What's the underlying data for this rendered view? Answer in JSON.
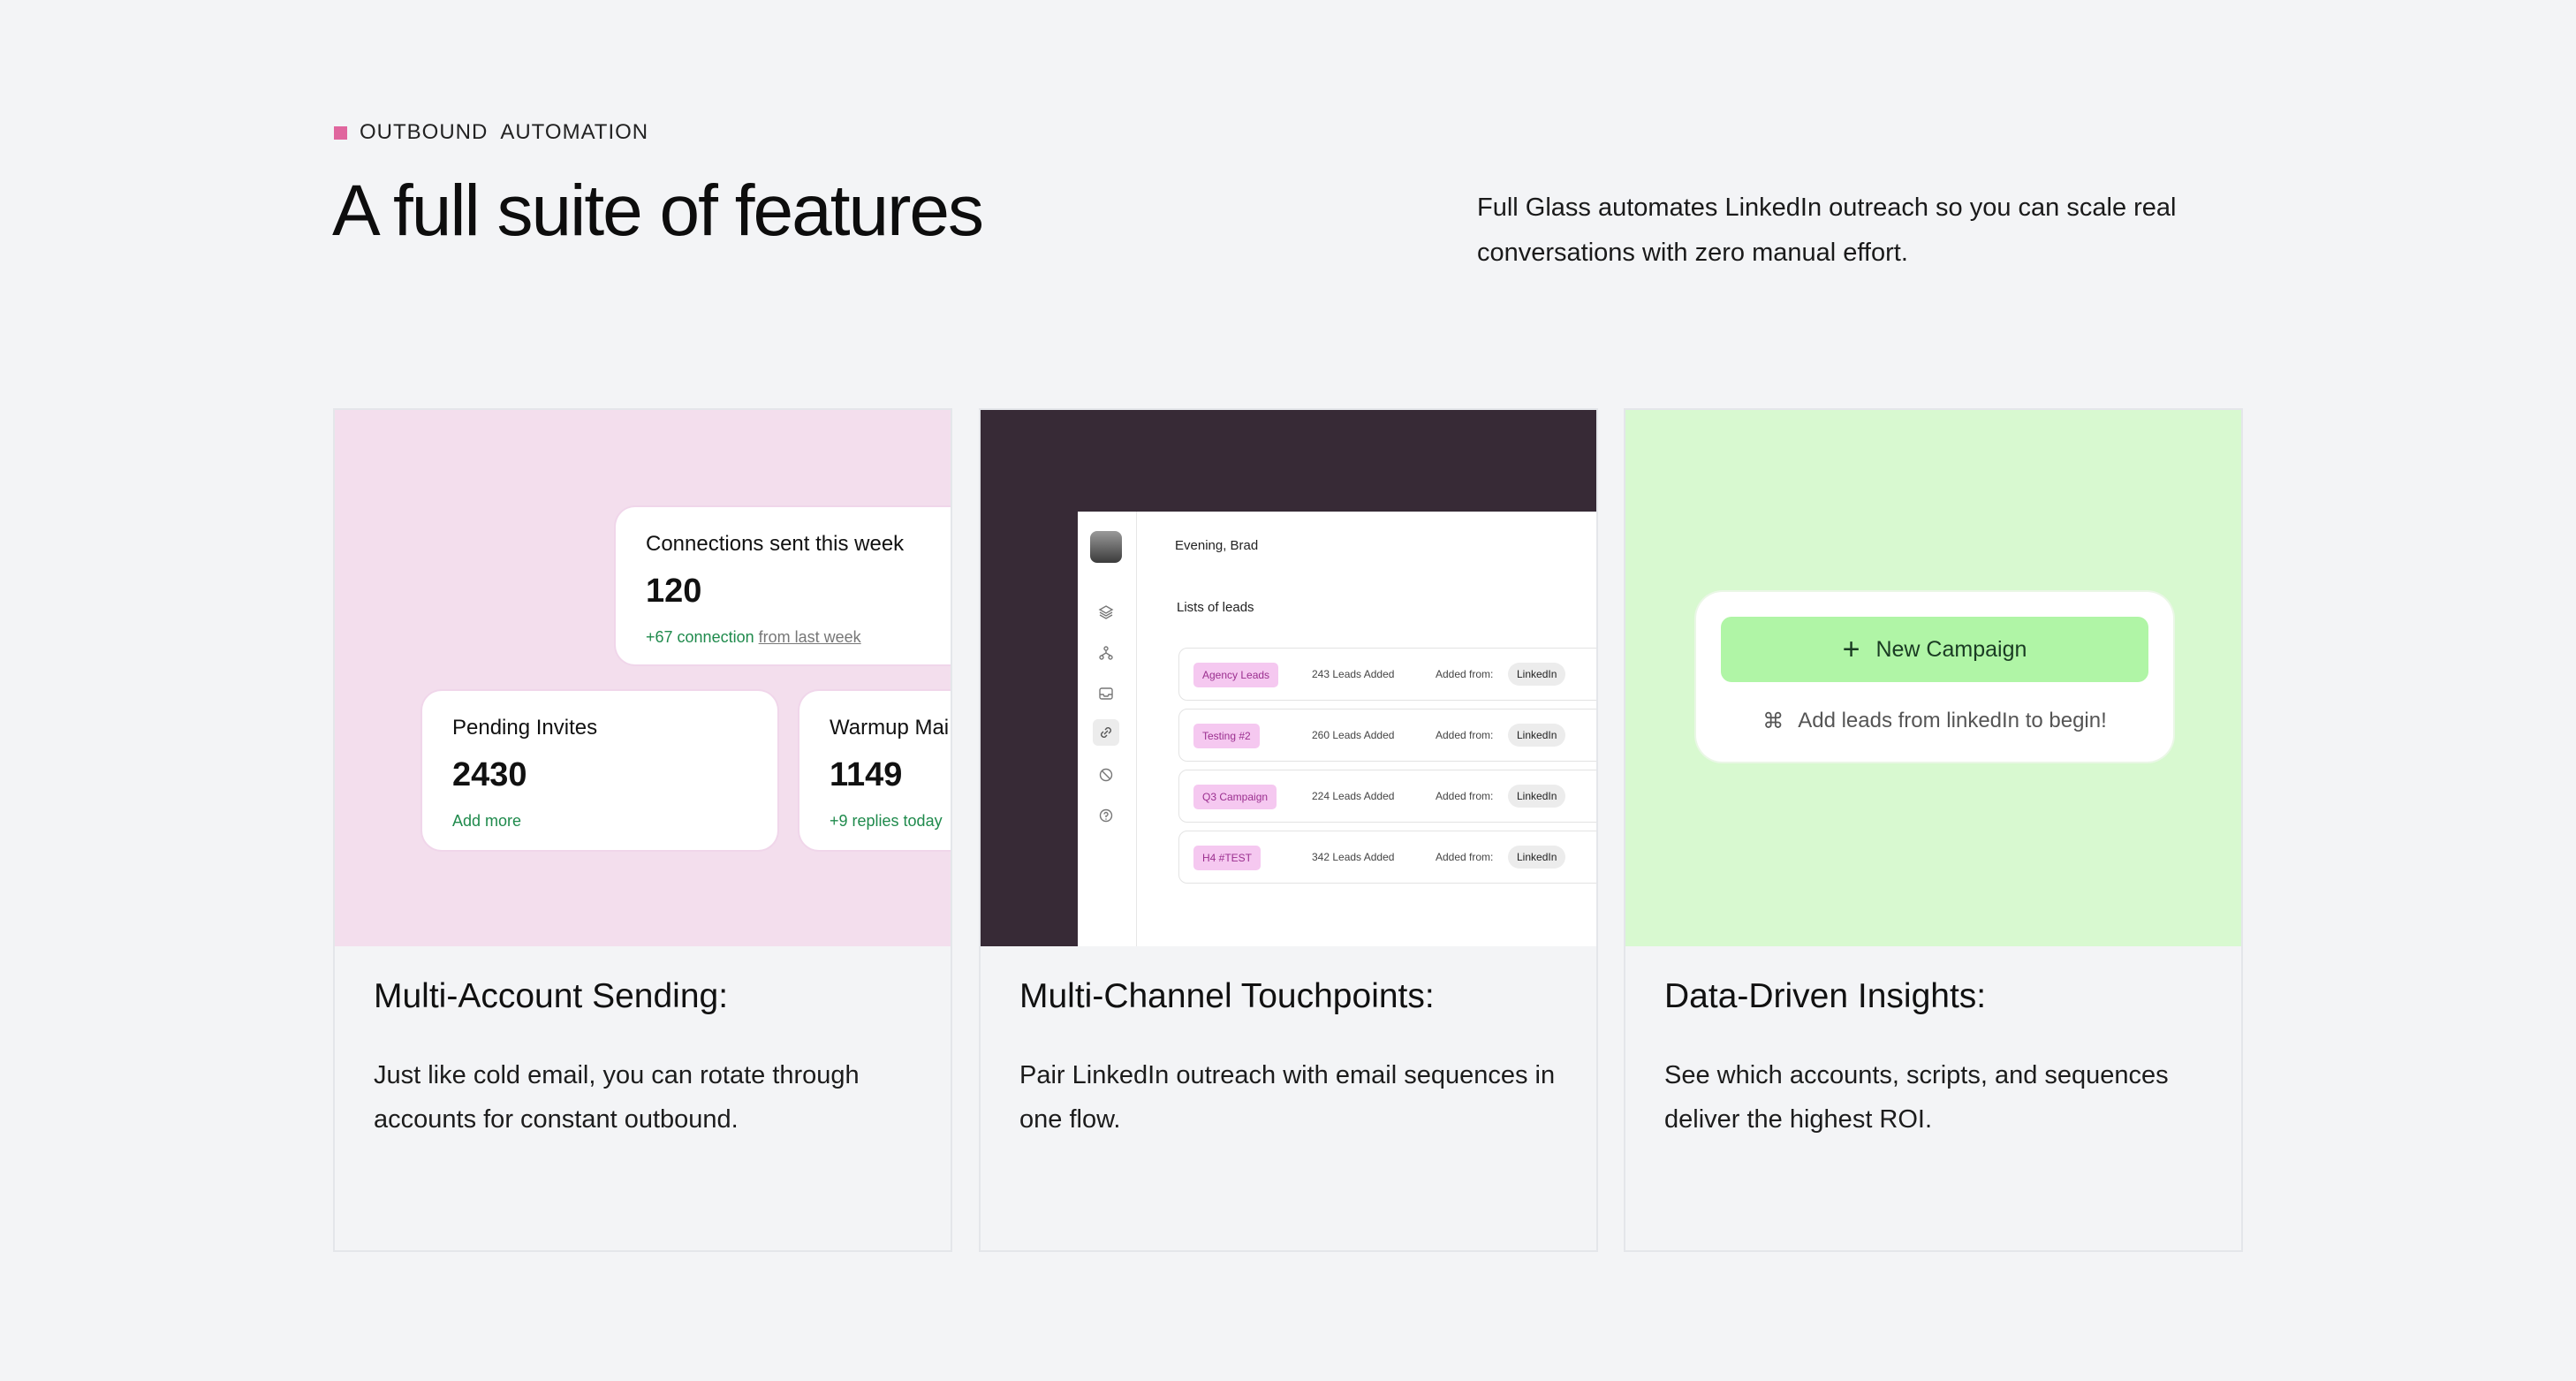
{
  "header": {
    "eyebrow": "OUTBOUND  AUTOMATION",
    "title": "A full suite of features",
    "intro": "Full Glass automates LinkedIn outreach so you can scale real conversations with zero manual effort."
  },
  "colors": {
    "eyebrow_dot": "#e0669e",
    "card1_bg": "#f3deed",
    "card2_bg": "#372a36",
    "card3_bg": "#d8f9d0",
    "accent_green": "#1f8a4c",
    "button_green": "#b0f5a6"
  },
  "cards": [
    {
      "title": "Multi-Account Sending:",
      "description": "Just like cold email, you can rotate through accounts for constant outbound.",
      "stats": [
        {
          "label": "Connections sent this week",
          "value": "120",
          "sub": "+67 connection",
          "sub_muted": "from last week"
        },
        {
          "label": "Pending Invites",
          "value": "2430",
          "sub": "Add more"
        },
        {
          "label": "Warmup Mai",
          "value": "1149",
          "sub": "+9 replies today"
        }
      ]
    },
    {
      "title": "Multi-Channel Touchpoints:",
      "description": "Pair LinkedIn outreach with email sequences in one flow.",
      "app": {
        "greeting": "Evening, Brad",
        "lists_title": "Lists of leads",
        "sidebar_icons": [
          "layers-icon",
          "network-icon",
          "inbox-icon",
          "link-icon",
          "blocked-icon",
          "help-icon"
        ],
        "leads": [
          {
            "tag": "Agency Leads",
            "count": "243 Leads Added",
            "from_label": "Added from:",
            "source": "LinkedIn"
          },
          {
            "tag": "Testing #2",
            "count": "260 Leads Added",
            "from_label": "Added from:",
            "source": "LinkedIn"
          },
          {
            "tag": "Q3 Campaign",
            "count": "224 Leads Added",
            "from_label": "Added from:",
            "source": "LinkedIn"
          },
          {
            "tag": "H4 #TEST",
            "count": "342 Leads Added",
            "from_label": "Added from:",
            "source": "LinkedIn"
          }
        ]
      }
    },
    {
      "title": "Data-Driven Insights:",
      "description": "See which accounts, scripts, and sequences deliver the highest ROI.",
      "campaign": {
        "button": "New Campaign",
        "hint": "Add leads from linkedIn to begin!"
      }
    }
  ]
}
